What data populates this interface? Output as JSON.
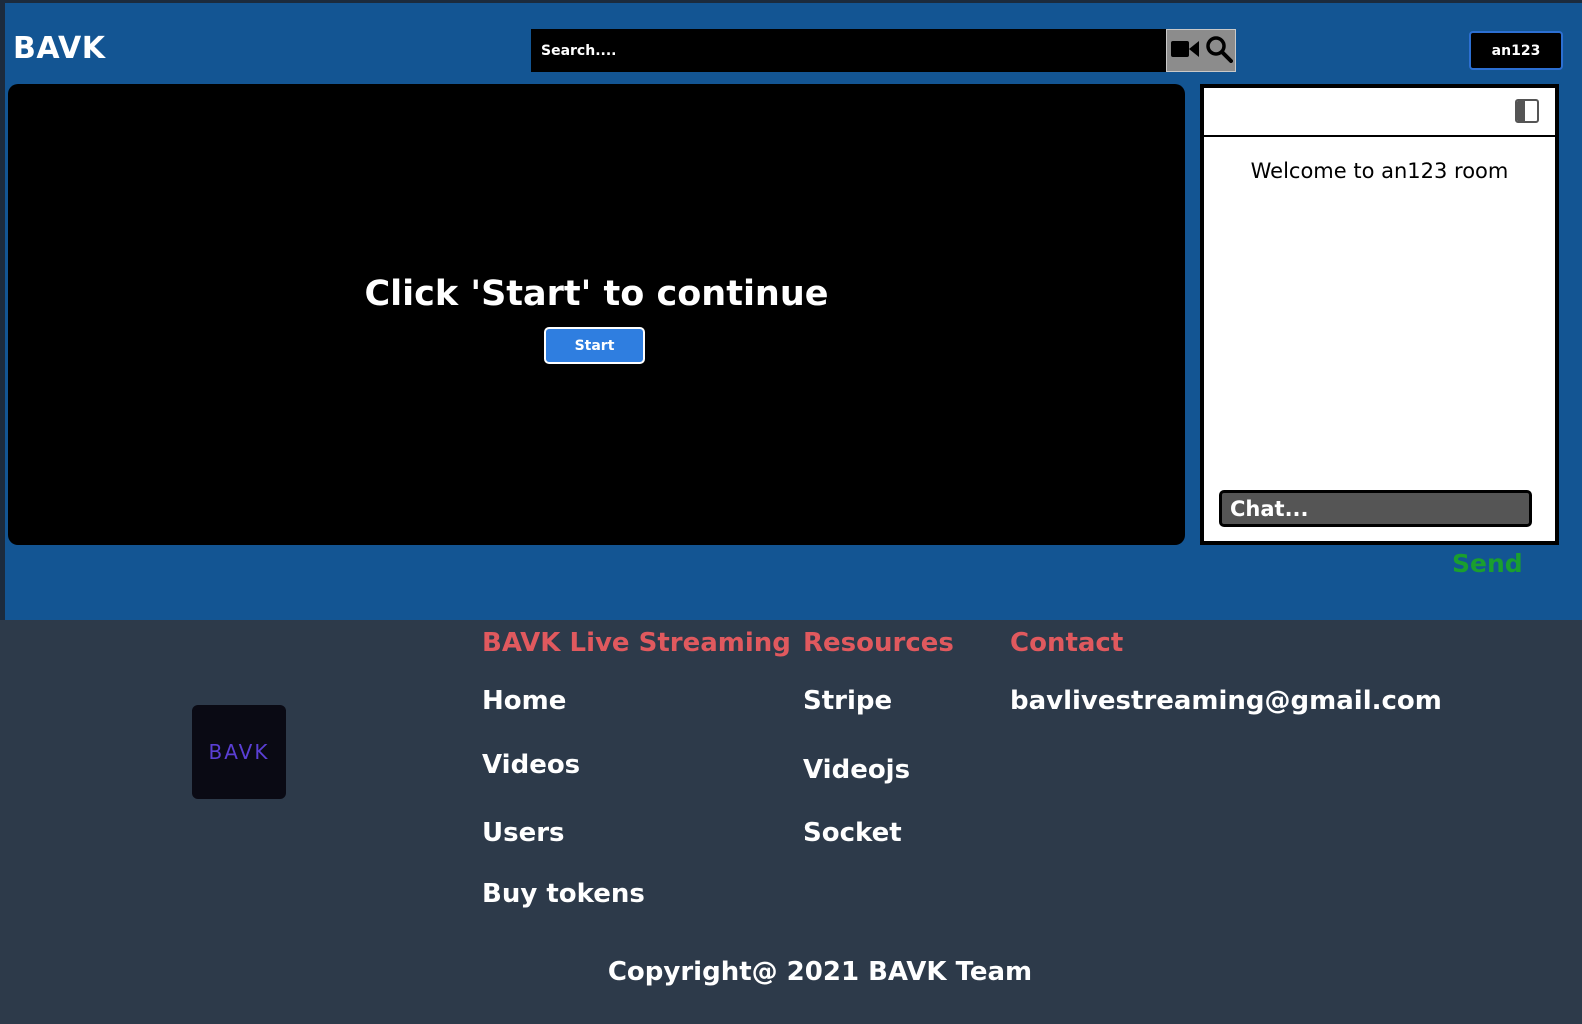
{
  "header": {
    "brand": "BAVK",
    "search_placeholder": "Search....",
    "video_icon": "video-camera-icon",
    "search_icon": "magnifier-icon",
    "user_label": "an123"
  },
  "player": {
    "message": "Click 'Start' to continue",
    "start_label": "Start"
  },
  "chat": {
    "collapse_icon": "sidebar-collapse-icon",
    "welcome": "Welcome to an123 room",
    "input_placeholder": "Chat...",
    "send_label": "Send"
  },
  "footer": {
    "logo_text": "BAVK",
    "columns": [
      {
        "heading": "BAVK Live Streaming",
        "links": [
          "Home",
          "Videos",
          "Users",
          "Buy tokens"
        ]
      },
      {
        "heading": "Resources",
        "links": [
          "Stripe",
          "Videojs",
          "Socket"
        ]
      },
      {
        "heading": "Contact",
        "links": [
          "bavlivestreaming@gmail.com"
        ]
      }
    ],
    "copyright": "Copyright@ 2021 BAVK Team"
  },
  "colors": {
    "header_bg": "#135593",
    "footer_bg": "#2d3a4a",
    "footer_heading": "#e0595e",
    "send": "#1a9f2e",
    "start_button": "#2f7ee0"
  }
}
